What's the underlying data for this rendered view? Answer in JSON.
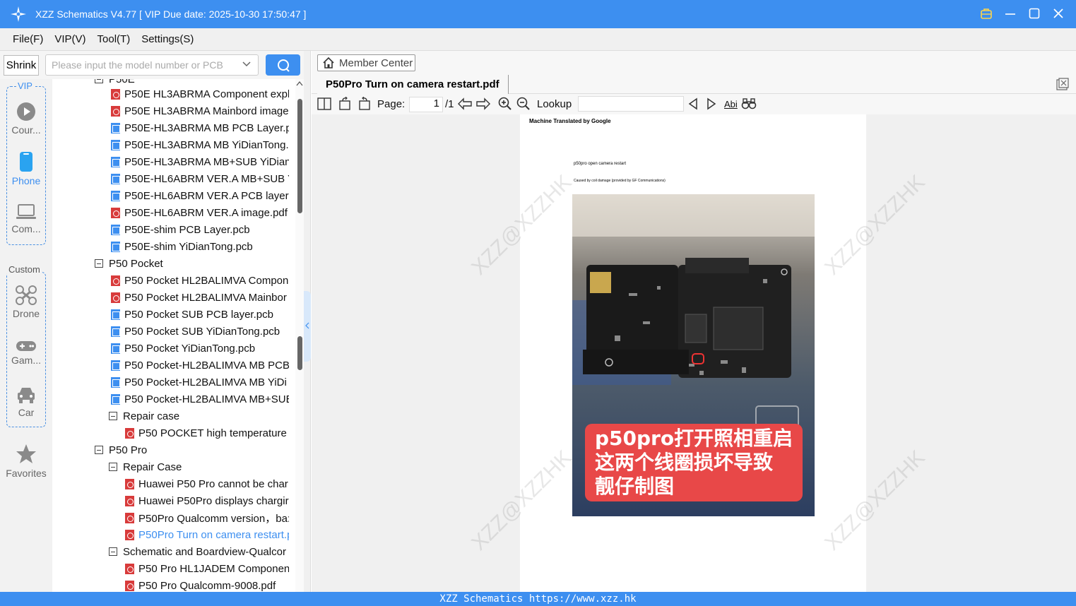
{
  "app": {
    "title": "XZZ Schematics V4.77 [ VIP Due date: 2025-10-30 17:50:47 ]",
    "accent": "#3d8ff0"
  },
  "menu": [
    "File(F)",
    "VIP(V)",
    "Tool(T)",
    "Settings(S)"
  ],
  "search": {
    "shrink_label": "Shrink",
    "placeholder": "Please input the model number or PCB"
  },
  "sidebar": {
    "vip_label": "VIP",
    "custom_label": "Custom",
    "vip_items": [
      {
        "label": "Cour...",
        "icon": "play-icon"
      },
      {
        "label": "Phone",
        "icon": "phone-icon"
      },
      {
        "label": "Com...",
        "icon": "laptop-icon"
      }
    ],
    "custom_items": [
      {
        "label": "Drone",
        "icon": "drone-icon"
      },
      {
        "label": "Gam...",
        "icon": "gamepad-icon"
      },
      {
        "label": "Car",
        "icon": "car-icon"
      }
    ],
    "favorites_label": "Favorites"
  },
  "tree": {
    "clipped_header": "P50E",
    "rows": [
      {
        "label": "P50E HL3ABRMA Component expl",
        "type": "pdf",
        "indent": 2
      },
      {
        "label": "P50E HL3ABRMA Mainbord image",
        "type": "pdf",
        "indent": 2
      },
      {
        "label": "P50E-HL3ABRMA MB PCB Layer.pc",
        "type": "pcb",
        "indent": 2
      },
      {
        "label": "P50E-HL3ABRMA MB YiDianTong.",
        "type": "pcb",
        "indent": 2
      },
      {
        "label": "P50E-HL3ABRMA MB+SUB YiDian",
        "type": "pcb",
        "indent": 2
      },
      {
        "label": "P50E-HL6ABRM VER.A MB+SUB Yi",
        "type": "pcb",
        "indent": 2
      },
      {
        "label": "P50E-HL6ABRM VER.A PCB layer.p",
        "type": "pcb",
        "indent": 2
      },
      {
        "label": "P50E-HL6ABRM VER.A image.pdf",
        "type": "pdf",
        "indent": 2
      },
      {
        "label": "P50E-shim PCB Layer.pcb",
        "type": "pcb",
        "indent": 2
      },
      {
        "label": "P50E-shim YiDianTong.pcb",
        "type": "pcb",
        "indent": 2
      },
      {
        "label": "P50 Pocket",
        "type": "folder",
        "indent": 1
      },
      {
        "label": "P50 Pocket HL2BALIMVA Compon",
        "type": "pdf",
        "indent": 2
      },
      {
        "label": "P50 Pocket HL2BALIMVA Mainbor",
        "type": "pdf",
        "indent": 2
      },
      {
        "label": "P50 Pocket SUB PCB layer.pcb",
        "type": "pcb",
        "indent": 2
      },
      {
        "label": "P50 Pocket SUB YiDianTong.pcb",
        "type": "pcb",
        "indent": 2
      },
      {
        "label": "P50 Pocket YiDianTong.pcb",
        "type": "pcb",
        "indent": 2
      },
      {
        "label": "P50 Pocket-HL2BALIMVA MB PCB",
        "type": "pcb",
        "indent": 2
      },
      {
        "label": "P50 Pocket-HL2BALIMVA MB YiDi",
        "type": "pcb",
        "indent": 2
      },
      {
        "label": "P50 Pocket-HL2BALIMVA MB+SUE",
        "type": "pcb",
        "indent": 2
      },
      {
        "label": "Repair case",
        "type": "folder",
        "indent": 2
      },
      {
        "label": "P50 POCKET high temperature i",
        "type": "pdf",
        "indent": 3
      },
      {
        "label": "P50 Pro",
        "type": "folder",
        "indent": 1
      },
      {
        "label": "Repair Case",
        "type": "folder",
        "indent": 2
      },
      {
        "label": "Huawei P50 Pro cannot be char",
        "type": "pdf",
        "indent": 3
      },
      {
        "label": "Huawei P50Pro displays chargir",
        "type": "pdf",
        "indent": 3
      },
      {
        "label": "P50Pro Qualcomm version，ba:",
        "type": "pdf",
        "indent": 3
      },
      {
        "label": "P50Pro Turn on camera restart.p",
        "type": "pdf",
        "indent": 3,
        "selected": true
      },
      {
        "label": "Schematic and Boardview-Qualcor",
        "type": "folder",
        "indent": 2
      },
      {
        "label": "P50 Pro HL1JADEM Componen",
        "type": "pdf",
        "indent": 3
      },
      {
        "label": "P50 Pro Qualcomm-9008.pdf",
        "type": "pdf",
        "indent": 3
      }
    ]
  },
  "viewer": {
    "member_center": "Member Center",
    "tab_title": "P50Pro Turn on camera restart.pdf",
    "page_label": "Page:",
    "page_value": "1",
    "page_total": "/1",
    "lookup_label": "Lookup",
    "abi_label": "Abi"
  },
  "document": {
    "machine_translated": "Machine Translated by Google",
    "heading": "p50pro open camera restart",
    "subheading": "Caused by coil damage (provided by GF Communications)",
    "caption_lines": [
      "p50pro打开照相重启",
      "这两个线圈损坏导致",
      "靓仔制图"
    ],
    "watermark": "XZZ@XZZHK"
  },
  "footer": "XZZ Schematics https://www.xzz.hk"
}
